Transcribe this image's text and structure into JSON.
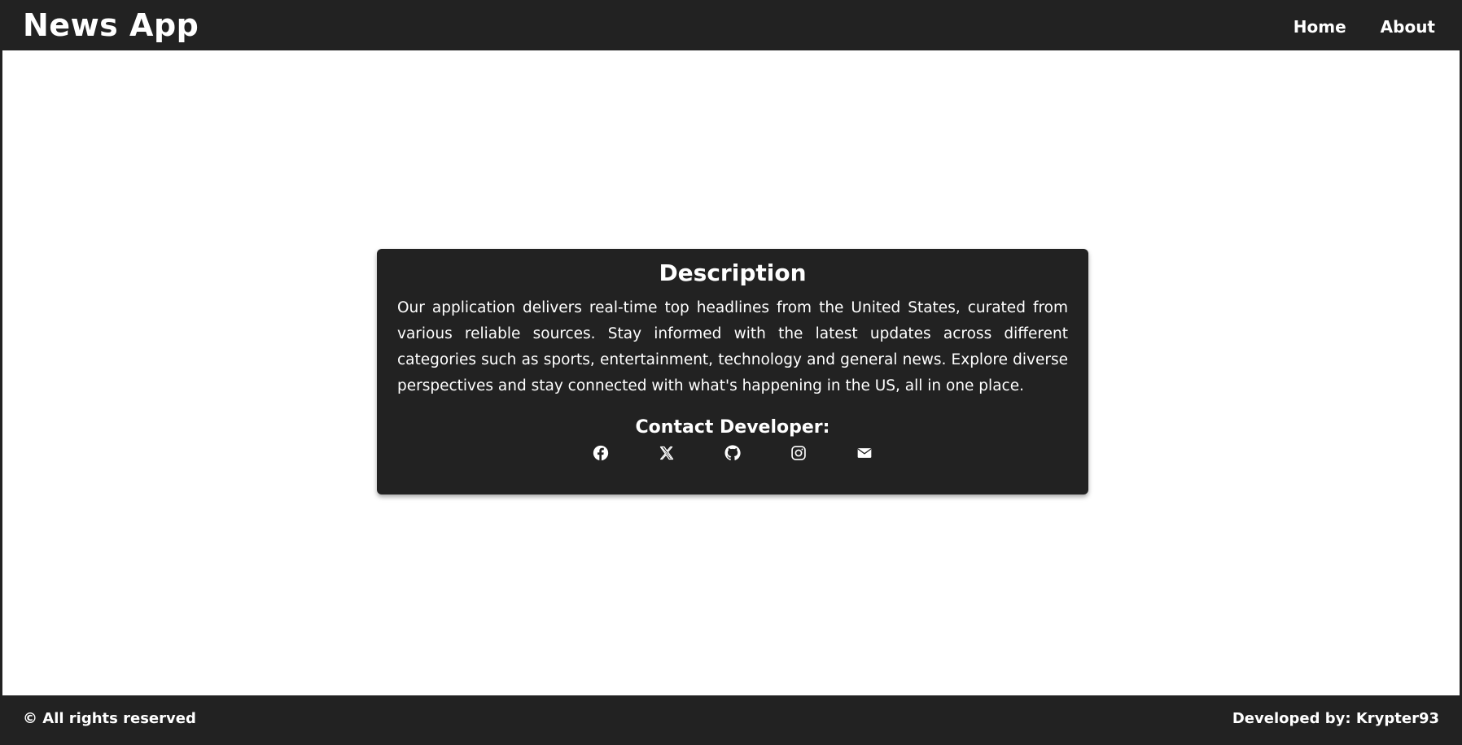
{
  "navbar": {
    "brand": "News App",
    "links": [
      {
        "label": "Home"
      },
      {
        "label": "About"
      }
    ]
  },
  "card": {
    "title": "Description",
    "text": "Our application delivers real-time top headlines from the United States, curated from various reliable sources. Stay informed with the latest updates across different categories such as sports, entertainment, technology and general news. Explore diverse perspectives and stay connected with what's happening in the US, all in one place.",
    "contact_title": "Contact Developer:",
    "icons": [
      {
        "name": "facebook-icon"
      },
      {
        "name": "x-twitter-icon"
      },
      {
        "name": "github-icon"
      },
      {
        "name": "instagram-icon"
      },
      {
        "name": "email-icon"
      }
    ]
  },
  "footer": {
    "left": "© All rights reserved",
    "right": "Developed by: Krypter93"
  },
  "colors": {
    "dark": "#222222",
    "text": "#ffffff",
    "background": "#ffffff"
  }
}
